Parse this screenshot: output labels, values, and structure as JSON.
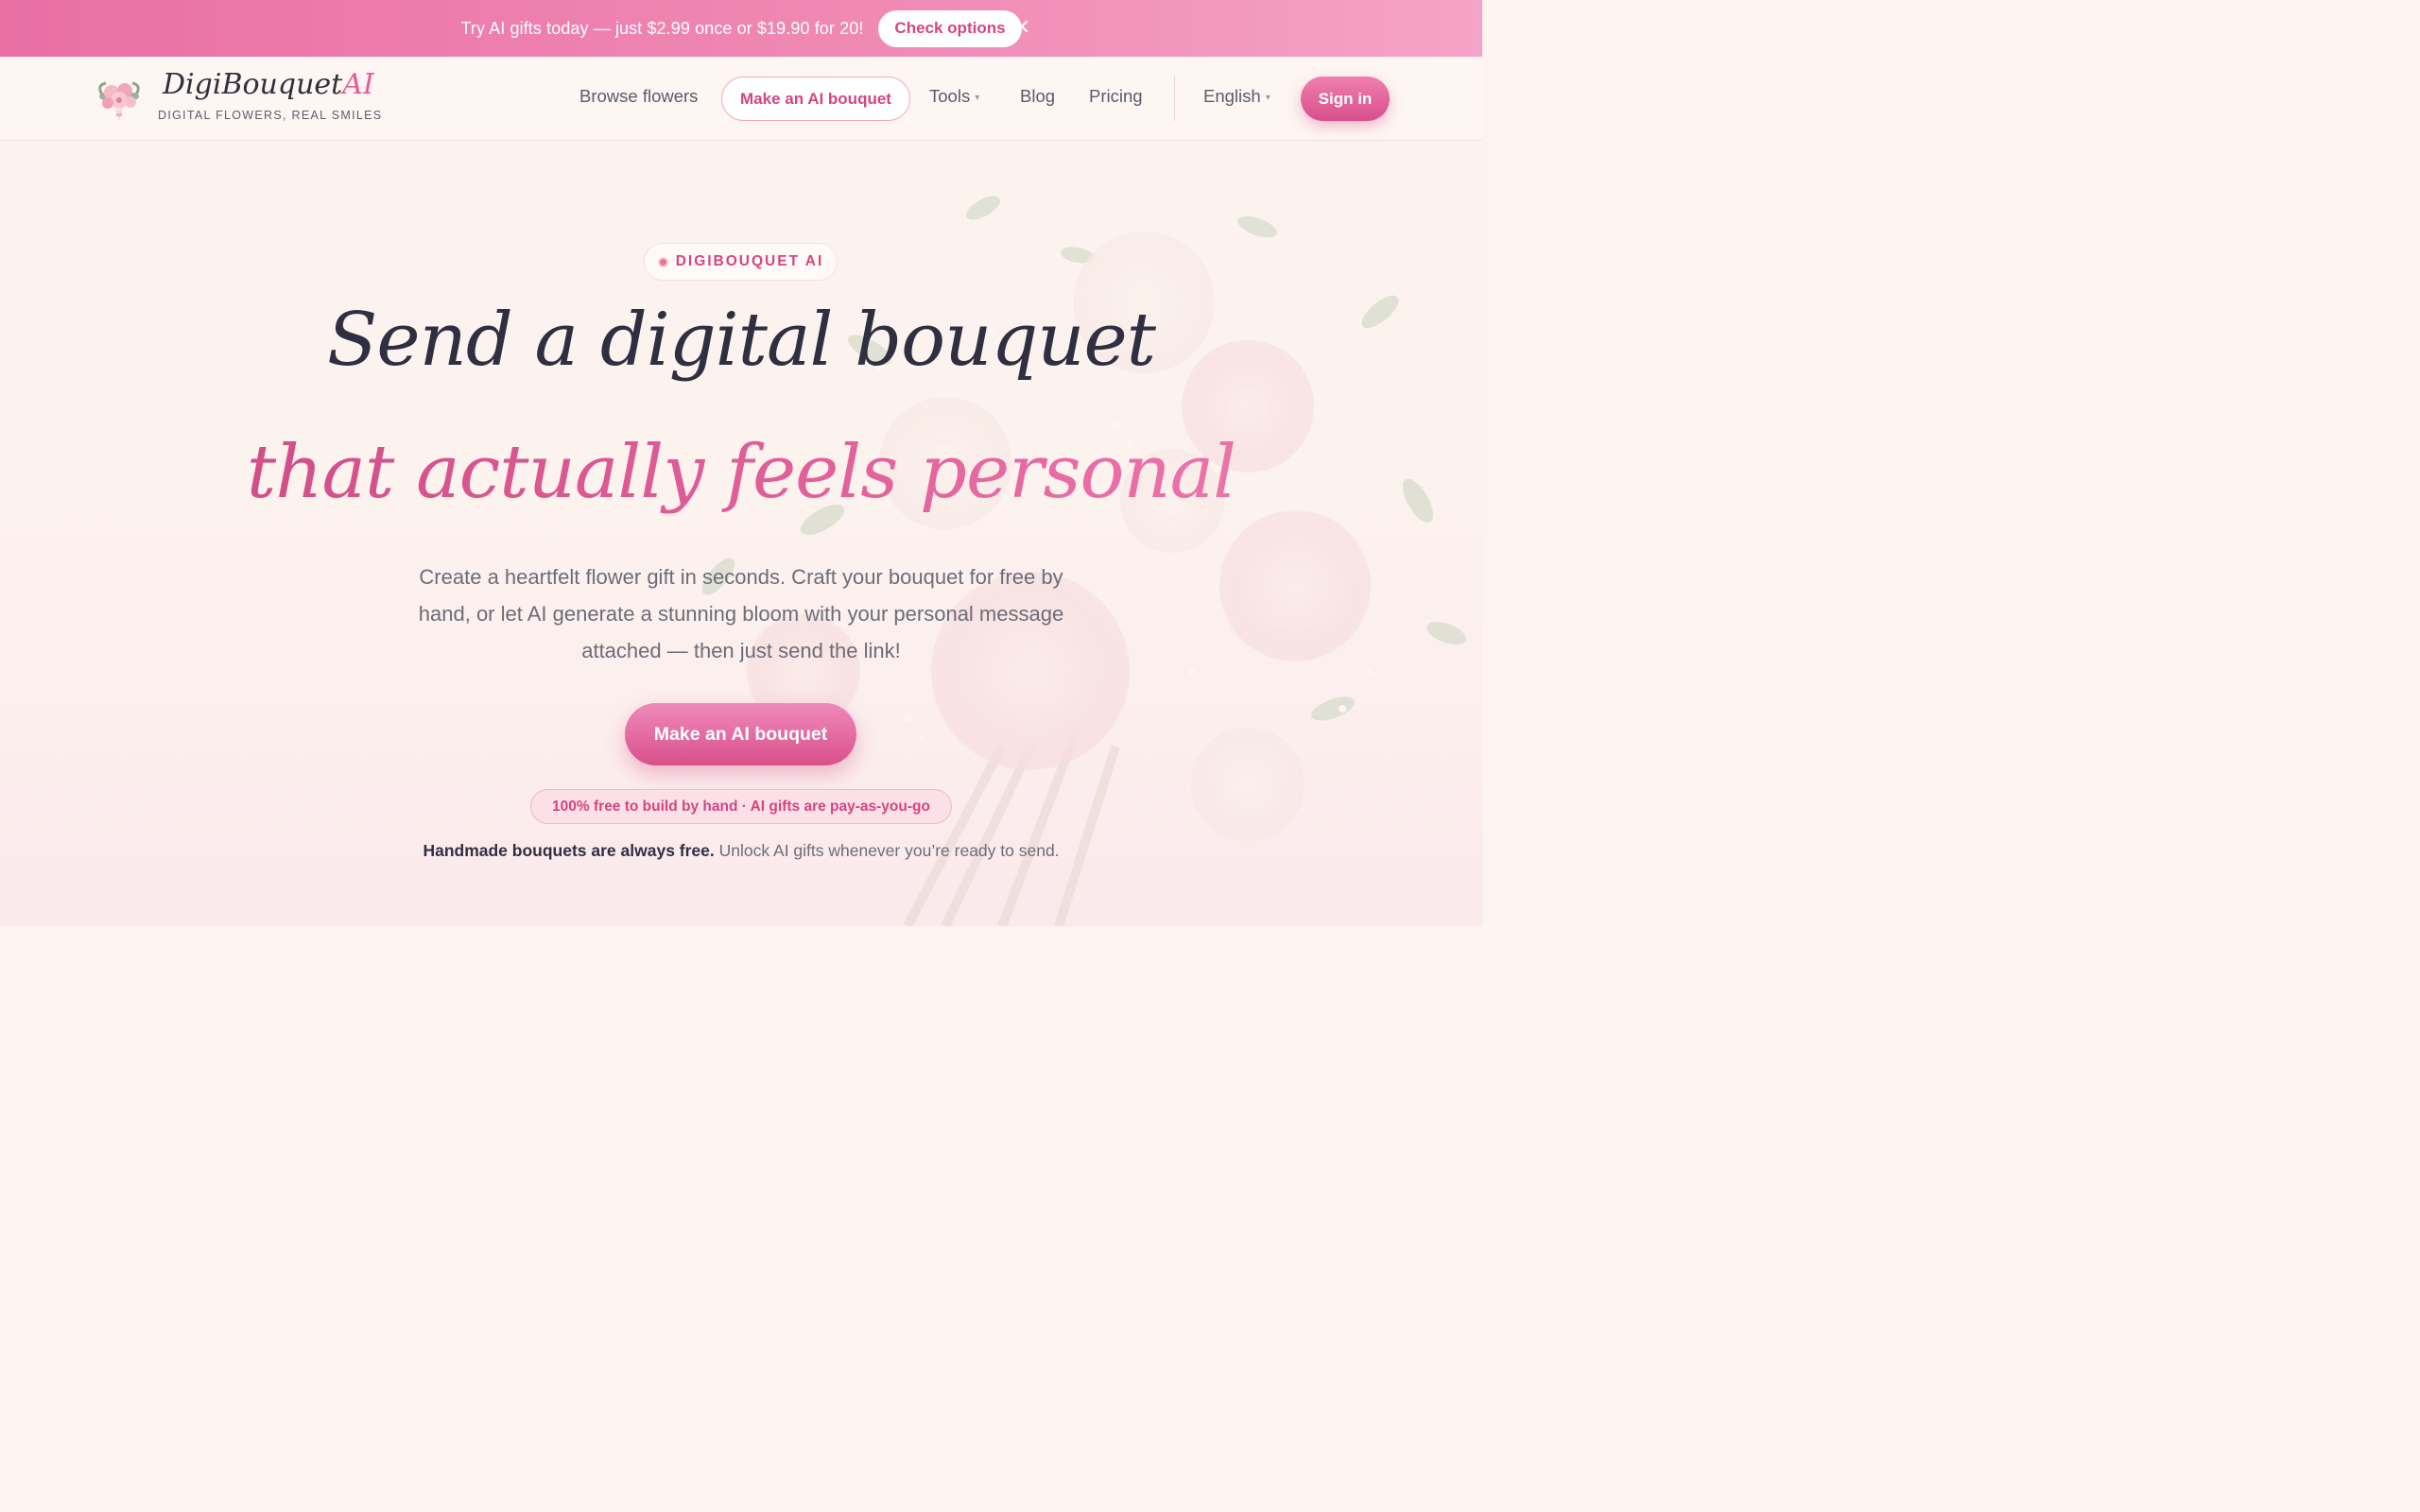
{
  "promo": {
    "text": "Try AI gifts today — just $2.99 once or $19.90 for 20!",
    "button_label": "Check options",
    "close_icon": "close-icon"
  },
  "header": {
    "logo": {
      "name_main": "DigiBouquet",
      "name_ai": "AI",
      "tagline": "DIGITAL FLOWERS, REAL SMILES",
      "icon": "bouquet-logo-icon"
    },
    "nav": {
      "browse": "Browse flowers",
      "make_ai": "Make an AI bouquet",
      "tools": "Tools",
      "blog": "Blog",
      "pricing": "Pricing"
    },
    "language": "English",
    "signin": "Sign in"
  },
  "hero": {
    "badge": "DIGIBOUQUET AI",
    "title_line1": "Send a digital bouquet",
    "title_line2": "that actually feels personal",
    "lead": "Create a heartfelt flower gift in seconds. Craft your bouquet for free by hand, or let AI generate a stunning bloom with your personal message attached — then just send the link!",
    "cta": "Make an AI bouquet",
    "pill": "100% free to build by hand · AI gifts are pay-as-you-go",
    "note_bold": "Handmade bouquets are always free.",
    "note_rest": " Unlock AI gifts whenever you’re ready to send."
  },
  "colors": {
    "accent": "#d9508b",
    "promo_bg": "#ee7fae",
    "page_bg": "#fcf3ef"
  }
}
